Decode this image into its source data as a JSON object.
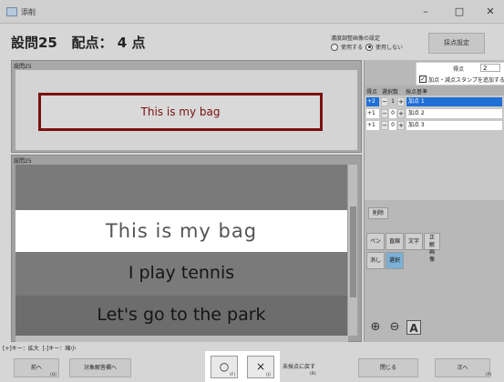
{
  "window": {
    "title": "添削",
    "minimize": "–",
    "maximize": "□",
    "close": "✕"
  },
  "header": {
    "question": "設問25",
    "points_label": "配点：",
    "points_value": "4 点",
    "density_label": "濃度調整画像の設定",
    "radio_use": "使用する",
    "radio_not_use": "使用しない",
    "radio_selected": "使用しない",
    "settings_button": "採点設定"
  },
  "panels": {
    "top_label": "設問25",
    "bottom_label": "設問25",
    "answer_text": "This is my bag",
    "strip_texts": [
      "This is my bag",
      "I play tennis",
      "Let's go to the park"
    ]
  },
  "scoring": {
    "score_label": "得点",
    "score_value": "2",
    "stamp_checkbox_label": "加点・減点スタンプを追加する",
    "stamp_checked": true,
    "columns": [
      "得点",
      "選択数",
      "採点基準"
    ],
    "rows": [
      {
        "points": "+2",
        "count": "1",
        "criterion": "加点 1",
        "selected": true
      },
      {
        "points": "+1",
        "count": "0",
        "criterion": "加点 2",
        "selected": false
      },
      {
        "points": "+1",
        "count": "0",
        "criterion": "加点 3",
        "selected": false
      }
    ]
  },
  "tools": {
    "delete": "削除",
    "pen": "ペン",
    "line": "直線",
    "text": "文字",
    "main_answer": "正解画像",
    "erase": "消し",
    "select": "選択"
  },
  "footer": {
    "key_hint_zoom_in": "[+]キー：拡大",
    "key_hint_zoom_out": "[-]キー：縮小",
    "prev": "前へ",
    "prev_key": "(Q)",
    "target_answer": "対象解答欄へ",
    "circle_mark": "○",
    "circle_key": "(F)",
    "cross_mark": "×",
    "cross_key": "(J)",
    "unmark": "未採点に戻す",
    "unmark_key": "(R)",
    "close": "閉じる",
    "next": "次へ",
    "next_key": "(P)"
  }
}
